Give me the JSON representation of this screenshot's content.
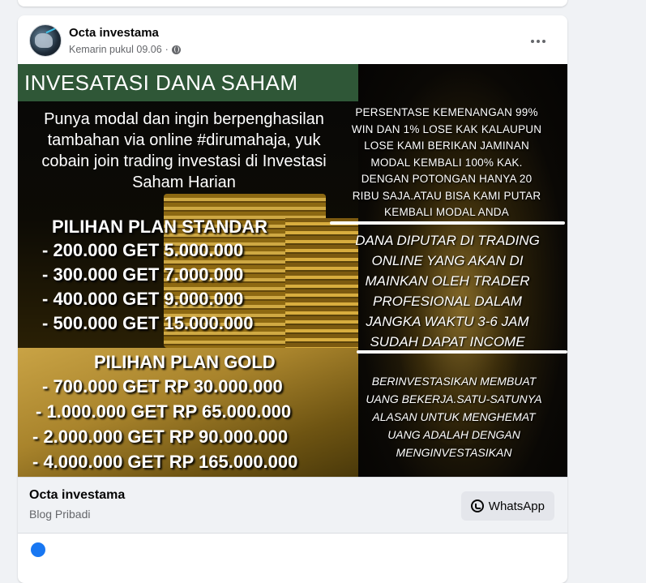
{
  "post": {
    "page_name": "Octa investama",
    "timestamp": "Kemarin pukul 09.06",
    "separator": "·",
    "privacy_icon": "globe-icon"
  },
  "image": {
    "title": "INVESATASI DANA SAHAM",
    "intro": [
      "Punya modal dan ingin berpenghasilan",
      "tambahan via online #dirumahaja, yuk",
      "cobain join trading investasi di Investasi",
      "Saham Harian"
    ],
    "plan_standard": {
      "title": "PILIHAN PLAN STANDAR",
      "items": [
        "-  200.000 GET 5.000.000",
        "-  300.000 GET 7.000.000",
        "-  400.000 GET 9.000.000",
        "-  500.000 GET 15.000.000"
      ]
    },
    "plan_gold": {
      "title": "PILIHAN PLAN GOLD",
      "items": [
        "-  700.000 GET RP 30.000.000",
        "-  1.000.000 GET RP 65.000.000",
        "-  2.000.000 GET RP 90.000.000",
        "-  4.000.000 GET RP 165.000.000"
      ]
    },
    "right_block_1": [
      "PERSENTASE KEMENANGAN 99%",
      "WIN DAN 1% LOSE KAK KALAUPUN",
      "LOSE KAMI BERIKAN JAMINAN",
      "MODAL KEMBALI 100% KAK.",
      "DENGAN POTONGAN HANYA 20",
      "RIBU SAJA.ATAU BISA KAMI PUTAR",
      "KEMBALI MODAL ANDA"
    ],
    "right_block_2": [
      "DANA DIPUTAR DI TRADING",
      "ONLINE YANG AKAN DI",
      "MAINKAN OLEH TRADER",
      "PROFESIONAL DALAM",
      "JANGKA WAKTU 3-6 JAM",
      "SUDAH DAPAT INCOME"
    ],
    "right_block_3": [
      "BERINVESTASIKAN MEMBUAT",
      "UANG BEKERJA.SATU-SATUNYA",
      "ALASAN UNTUK MENGHEMAT",
      "UANG ADALAH DENGAN",
      "MENGINVESTASIKAN"
    ]
  },
  "footer": {
    "name": "Octa investama",
    "subtitle": "Blog Pribadi",
    "button_label": "WhatsApp",
    "button_icon": "whatsapp-icon"
  },
  "colors": {
    "title_bar": "#2f5737",
    "background": "#f0f2f5",
    "card": "#ffffff",
    "muted_text": "#65676b"
  }
}
